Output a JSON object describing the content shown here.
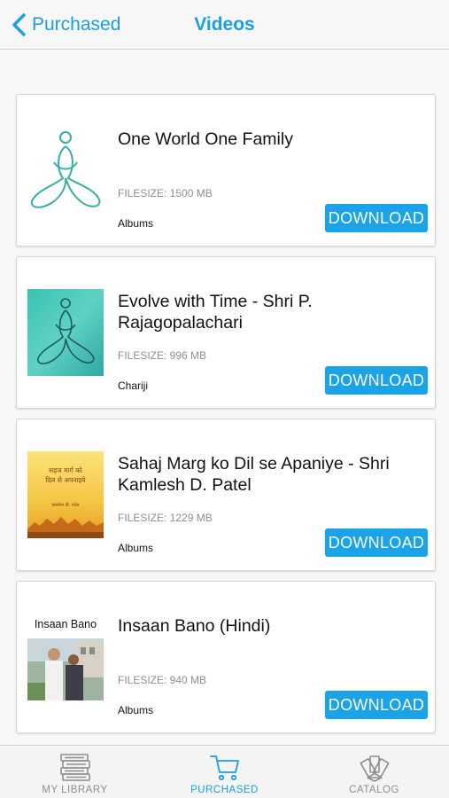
{
  "navbar": {
    "back_label": "Purchased",
    "title": "Videos"
  },
  "items": [
    {
      "title": "One World One Family",
      "filesize": "FILESIZE: 1500 MB",
      "category": "Albums",
      "button": "DOWNLOAD"
    },
    {
      "title": "Evolve with Time - Shri P. Rajagopalachari",
      "filesize": "FILESIZE: 996 MB",
      "category": "Chariji",
      "button": "DOWNLOAD"
    },
    {
      "title": "Sahaj Marg ko Dil se Apaniye - Shri Kamlesh D. Patel",
      "filesize": "FILESIZE: 1229 MB",
      "category": "Albums",
      "button": "DOWNLOAD",
      "thumb_text": [
        "सहज मार्ग को",
        "दिल से अपनाइये",
        "कमलेश डी. पटेल"
      ]
    },
    {
      "title": "Insaan Bano (Hindi)",
      "filesize": "FILESIZE: 940 MB",
      "category": "Albums",
      "button": "DOWNLOAD",
      "thumb_text": "Insaan Bano"
    }
  ],
  "tabs": [
    {
      "label": "MY LIBRARY",
      "icon": "books-icon",
      "active": false
    },
    {
      "label": "PURCHASED",
      "icon": "cart-icon",
      "active": true
    },
    {
      "label": "CATALOG",
      "icon": "catalog-fan-icon",
      "active": false
    }
  ],
  "colors": {
    "accent": "#1a9ee6",
    "button": "#1aa3e8",
    "inactive_tab": "#8e8e8e"
  }
}
